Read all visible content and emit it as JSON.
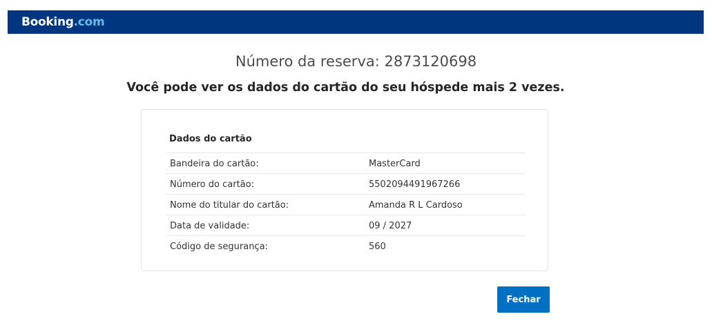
{
  "header": {
    "logo_brand": "Booking",
    "logo_tld": ".com"
  },
  "reservation": {
    "label": "Número da reserva: 2873120698"
  },
  "notice": "Você pode ver os dados do cartão do seu hóspede mais 2 vezes.",
  "card": {
    "title": "Dados do cartão",
    "rows": [
      {
        "label": "Bandeira do cartão:",
        "value": "MasterCard"
      },
      {
        "label": "Número do cartão:",
        "value": "5502094491967266"
      },
      {
        "label": "Nome do titular do cartão:",
        "value": "Amanda R L Cardoso"
      },
      {
        "label": "Data de validade:",
        "value": "09 / 2027"
      },
      {
        "label": "Código de segurança:",
        "value": "560"
      }
    ]
  },
  "actions": {
    "close_label": "Fechar"
  },
  "colors": {
    "header_bg": "#003580",
    "logo_tld": "#65bde7",
    "button_bg": "#0071c2"
  }
}
